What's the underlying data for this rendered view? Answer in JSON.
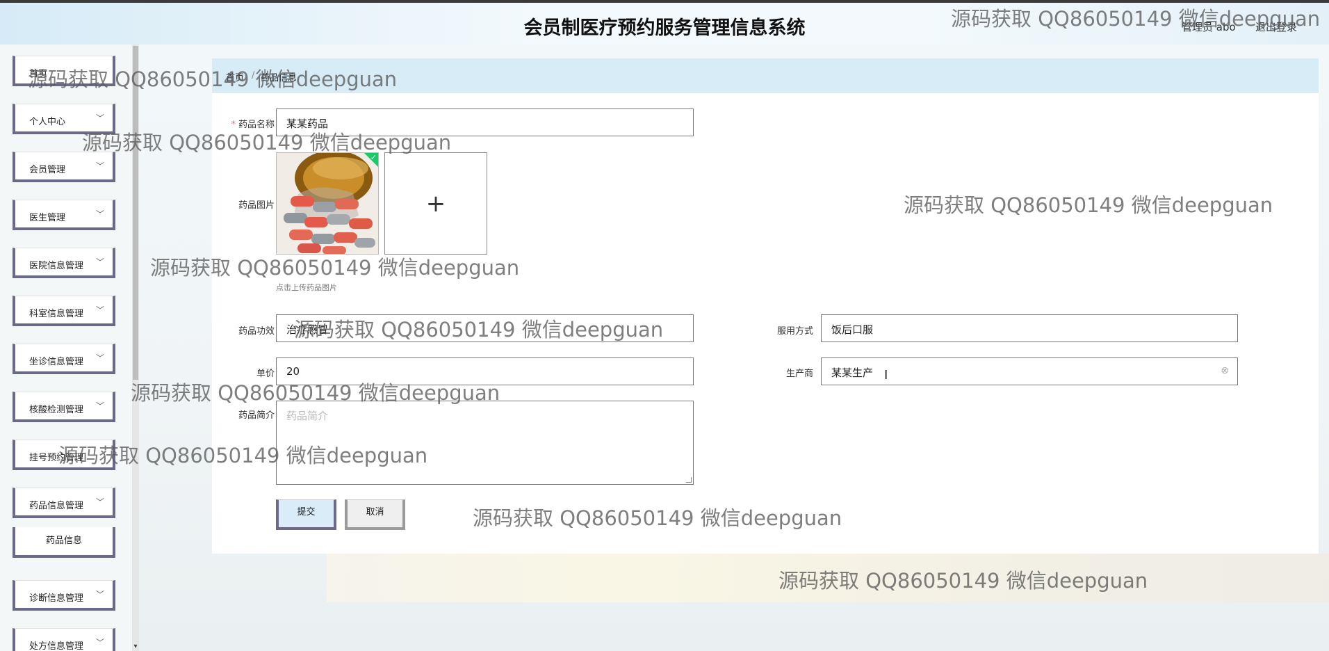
{
  "header": {
    "title": "会员制医疗预约服务管理信息系统",
    "user_label": "管理员 abo",
    "logout_label": "退出登录"
  },
  "sidebar": {
    "items": [
      {
        "label": "首页",
        "has_chevron": false
      },
      {
        "label": "个人中心",
        "has_chevron": true
      },
      {
        "label": "会员管理",
        "has_chevron": true
      },
      {
        "label": "医生管理",
        "has_chevron": true
      },
      {
        "label": "医院信息管理",
        "has_chevron": true
      },
      {
        "label": "科室信息管理",
        "has_chevron": true
      },
      {
        "label": "坐诊信息管理",
        "has_chevron": true
      },
      {
        "label": "核酸检测管理",
        "has_chevron": true
      },
      {
        "label": "挂号预约管理",
        "has_chevron": false
      },
      {
        "label": "药品信息管理",
        "has_chevron": true
      },
      {
        "label": "诊断信息管理",
        "has_chevron": true
      },
      {
        "label": "处方信息管理",
        "has_chevron": true
      }
    ],
    "sub_item": "药品信息"
  },
  "breadcrumb": {
    "home": "首页",
    "separator": "/",
    "current": "药品信息"
  },
  "form": {
    "name_label": "药品名称",
    "name_required_mark": "*",
    "name_value": "某某药品",
    "image_label": "药品图片",
    "image_hint": "点击上传药品图片",
    "add_symbol": "+",
    "effect_label": "药品功效",
    "effect_value": "治疗感冒",
    "usage_label": "服用方式",
    "usage_value": "饭后口服",
    "price_label": "单价",
    "price_value": "20",
    "maker_label": "生产商",
    "maker_value": "某某生产",
    "intro_label": "药品简介",
    "intro_placeholder": "药品简介",
    "submit_label": "提交",
    "cancel_label": "取消"
  },
  "watermark_text": "源码获取 QQ86050149 微信deepguan",
  "colors": {
    "accent": "#6a6a88",
    "breadcrumb_bg": "#d8ecf8",
    "success": "#13ce66"
  }
}
